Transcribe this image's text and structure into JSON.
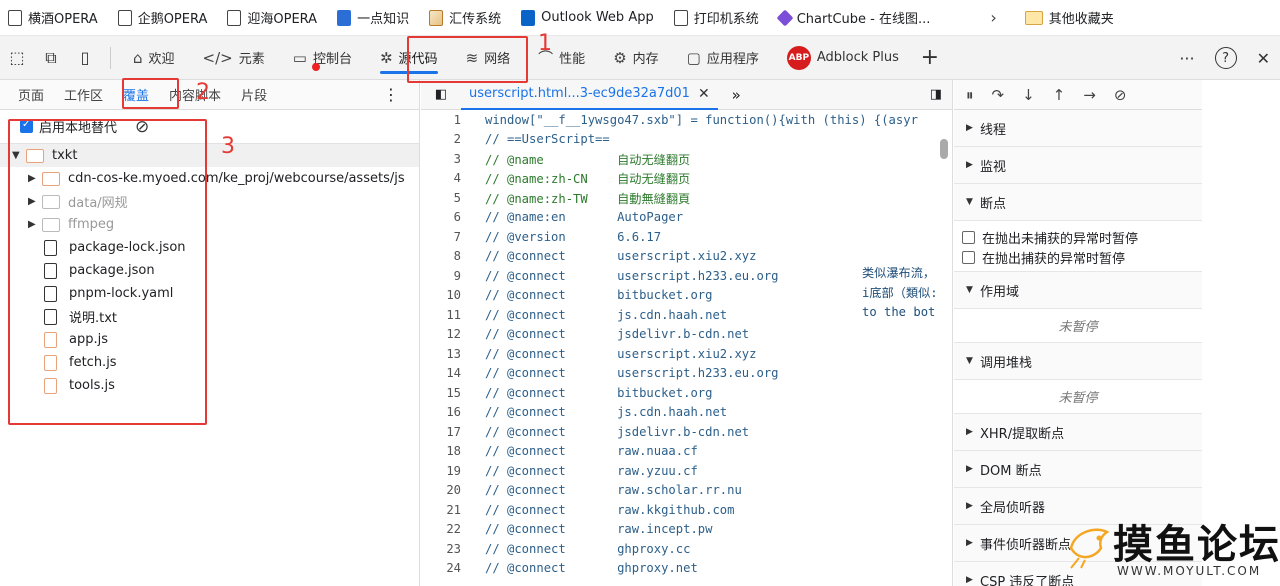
{
  "bookmarks": [
    {
      "label": "横酒OPERA",
      "icon": "page-icon"
    },
    {
      "label": "企鹅OPERA",
      "icon": "page-icon"
    },
    {
      "label": "迎海OPERA",
      "icon": "page-icon"
    },
    {
      "label": "一点知识",
      "icon": "blue-app-icon"
    },
    {
      "label": "汇传系统",
      "icon": "image-icon"
    },
    {
      "label": "Outlook Web App",
      "icon": "outlook-icon"
    },
    {
      "label": "打印机系统",
      "icon": "page-icon"
    },
    {
      "label": "ChartCube - 在线图...",
      "icon": "cube-icon"
    }
  ],
  "bookmarks_more": "›",
  "bookmarks_folder": "其他收藏夹",
  "devtools_tabs": [
    {
      "label": "欢迎",
      "icon": "home-icon"
    },
    {
      "label": "元素",
      "icon": "code-icon"
    },
    {
      "label": "控制台",
      "icon": "console-icon"
    },
    {
      "label": "源代码",
      "icon": "bug-icon"
    },
    {
      "label": "网络",
      "icon": "wifi-icon"
    },
    {
      "label": "性能",
      "icon": "performance-icon"
    },
    {
      "label": "内存",
      "icon": "memory-icon"
    },
    {
      "label": "应用程序",
      "icon": "application-icon"
    },
    {
      "label": "Adblock Plus",
      "icon": "abp-icon"
    }
  ],
  "abp_badge": "ABP",
  "tabbar_add": "+",
  "tabbar_right": {
    "more": "···",
    "help": "?",
    "close": "✕"
  },
  "annotations": {
    "n1": "1",
    "n2": "2",
    "n3": "3"
  },
  "navigator": {
    "tabs": [
      "页面",
      "工作区",
      "覆盖",
      "内容脚本",
      "片段"
    ],
    "kebab": "⋮",
    "enable_local_overrides": "启用本地替代",
    "root_folder": "txkt",
    "items": [
      {
        "type": "folder",
        "label": "cdn-cos-ke.myoed.com/ke_proj/webcourse/assets/js",
        "dim": false
      },
      {
        "type": "folder",
        "label": "data/网规",
        "dim": true
      },
      {
        "type": "folder",
        "label": "ffmpeg",
        "dim": true
      },
      {
        "type": "file",
        "label": "package-lock.json",
        "color": "black"
      },
      {
        "type": "file",
        "label": "package.json",
        "color": "black"
      },
      {
        "type": "file",
        "label": "pnpm-lock.yaml",
        "color": "black"
      },
      {
        "type": "file",
        "label": "说明.txt",
        "color": "black"
      },
      {
        "type": "file",
        "label": "app.js",
        "color": "orange"
      },
      {
        "type": "file",
        "label": "fetch.js",
        "color": "orange"
      },
      {
        "type": "file",
        "label": "tools.js",
        "color": "orange"
      }
    ]
  },
  "editor": {
    "tab_label": "userscript.html...3-ec9de32a7d01",
    "tab_close": "✕",
    "more": "»",
    "lines": [
      {
        "n": "1",
        "text": "window[\"__f__1ywsgo47.sxb\"] = function(){with (this) {(asyr"
      },
      {
        "n": "2",
        "text": "// ==UserScript=="
      },
      {
        "n": "3",
        "text": "// @name          自动无缝翻页"
      },
      {
        "n": "4",
        "text": "// @name:zh-CN    自动无缝翻页"
      },
      {
        "n": "5",
        "text": "// @name:zh-TW    自動無縫翻頁"
      },
      {
        "n": "6",
        "text": "// @name:en       AutoPager"
      },
      {
        "n": "7",
        "text": "// @version       6.6.17"
      },
      {
        "n": "8",
        "text": "// @connect       userscript.xiu2.xyz"
      },
      {
        "n": "9",
        "text": "// @connect       userscript.h233.eu.org"
      },
      {
        "n": "10",
        "text": "// @connect       bitbucket.org"
      },
      {
        "n": "11",
        "text": "// @connect       js.cdn.haah.net"
      },
      {
        "n": "12",
        "text": "// @connect       jsdelivr.b-cdn.net"
      },
      {
        "n": "13",
        "text": "// @connect       userscript.xiu2.xyz"
      },
      {
        "n": "14",
        "text": "// @connect       userscript.h233.eu.org"
      },
      {
        "n": "15",
        "text": "// @connect       bitbucket.org"
      },
      {
        "n": "16",
        "text": "// @connect       js.cdn.haah.net"
      },
      {
        "n": "17",
        "text": "// @connect       jsdelivr.b-cdn.net"
      },
      {
        "n": "18",
        "text": "// @connect       raw.nuaa.cf"
      },
      {
        "n": "19",
        "text": "// @connect       raw.yzuu.cf"
      },
      {
        "n": "20",
        "text": "// @connect       raw.scholar.rr.nu"
      },
      {
        "n": "21",
        "text": "// @connect       raw.kkgithub.com"
      },
      {
        "n": "22",
        "text": "// @connect       raw.incept.pw"
      },
      {
        "n": "23",
        "text": "// @connect       ghproxy.cc"
      },
      {
        "n": "24",
        "text": "// @connect       ghproxy.net"
      }
    ],
    "side_notes": [
      "类似瀑布流，",
      "i底部（類似:",
      "to the bot"
    ]
  },
  "debugger": {
    "sections_top": [
      "线程",
      "监视",
      "断点"
    ],
    "breakpoint_options": [
      "在抛出未捕获的异常时暂停",
      "在抛出捕获的异常时暂停"
    ],
    "scope": "作用域",
    "scope_status": "未暂停",
    "callstack": "调用堆栈",
    "callstack_status": "未暂停",
    "sections_bottom": [
      "XHR/提取断点",
      "DOM 断点",
      "全局侦听器",
      "事件侦听器断点",
      "CSP 违反了断点"
    ]
  },
  "watermark": {
    "title": "摸鱼论坛",
    "url": "WWW.MOYULT.COM"
  }
}
